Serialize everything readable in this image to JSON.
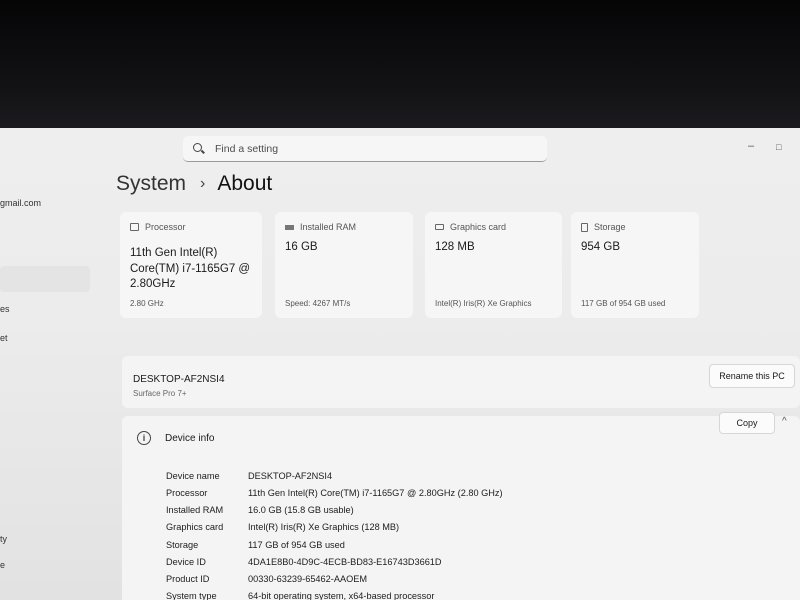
{
  "search": {
    "placeholder": "Find a setting"
  },
  "breadcrumb": {
    "parent": "System",
    "separator": "›",
    "current": "About"
  },
  "sidebar": {
    "email_fragment": "gmail.com",
    "fragments": [
      "es",
      "et",
      "ty",
      "e"
    ]
  },
  "window": {
    "minimize": "–",
    "maximize": "□"
  },
  "cards": [
    {
      "label": "Processor",
      "icon": "processor-icon",
      "value": "11th Gen Intel(R) Core(TM) i7-1165G7 @ 2.80GHz",
      "sub": "2.80 GHz"
    },
    {
      "label": "Installed RAM",
      "icon": "ram-icon",
      "value": "16 GB",
      "sub": "Speed: 4267 MT/s"
    },
    {
      "label": "Graphics card",
      "icon": "graphics-card-icon",
      "value": "128 MB",
      "sub": "Intel(R) Iris(R) Xe Graphics"
    },
    {
      "label": "Storage",
      "icon": "storage-icon",
      "value": "954 GB",
      "sub": "117 GB of 954 GB used"
    }
  ],
  "device": {
    "name": "DESKTOP-AF2NSI4",
    "model": "Surface Pro 7+",
    "rename_label": "Rename this PC"
  },
  "device_info": {
    "title": "Device info",
    "copy_label": "Copy",
    "rows": [
      {
        "label": "Device name",
        "value": "DESKTOP-AF2NSI4"
      },
      {
        "label": "Processor",
        "value": "11th Gen Intel(R) Core(TM) i7-1165G7 @ 2.80GHz (2.80 GHz)"
      },
      {
        "label": "Installed RAM",
        "value": "16.0 GB (15.8 GB usable)"
      },
      {
        "label": "Graphics card",
        "value": "Intel(R) Iris(R) Xe Graphics (128 MB)"
      },
      {
        "label": "Storage",
        "value": "117 GB of 954 GB used"
      },
      {
        "label": "Device ID",
        "value": "4DA1E8B0-4D9C-4ECB-BD83-E16743D3661D"
      },
      {
        "label": "Product ID",
        "value": "00330-63239-65462-AAOEM"
      },
      {
        "label": "System type",
        "value": "64-bit operating system, x64-based processor"
      }
    ]
  }
}
